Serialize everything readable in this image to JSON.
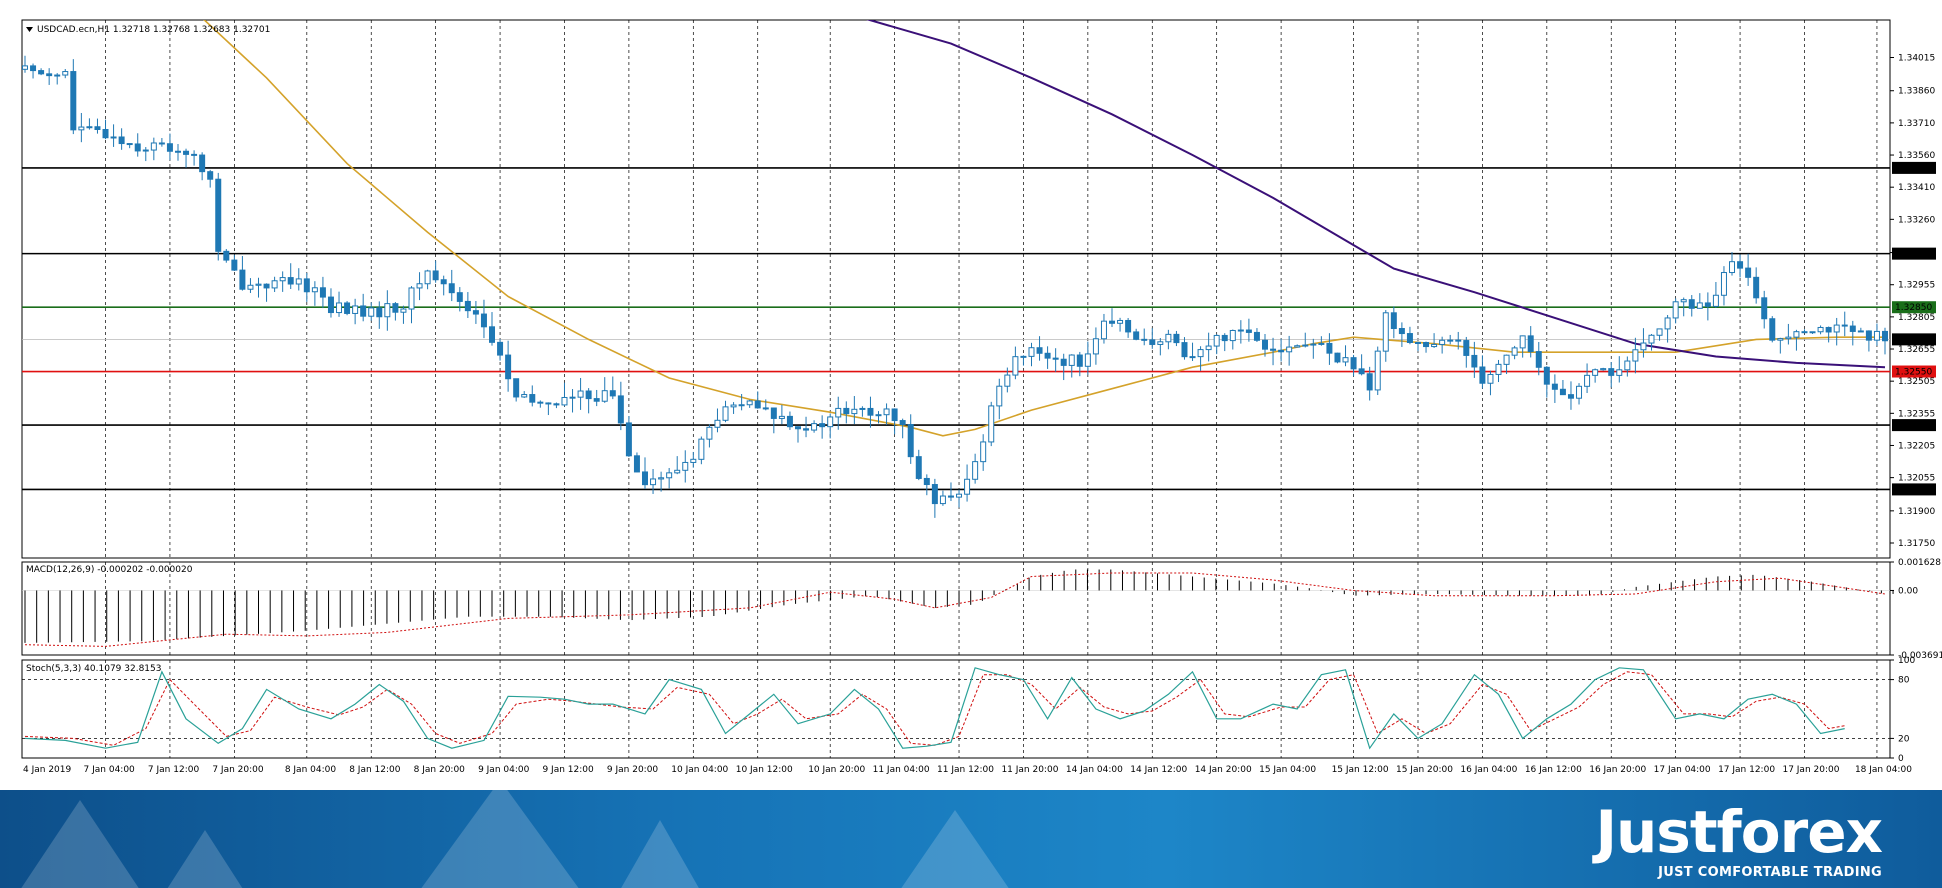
{
  "header": {
    "symbol_line": "USDCAD.ecn,H1  1.32718 1.32768 1.32683 1.32701",
    "macd_label": "MACD(12,26,9) -0.000202 -0.000020",
    "stoch_label": "Stoch(5,3,3) 40.1079 32.8153"
  },
  "brand": {
    "logo": "Justforex",
    "tagline": "JUST COMFORTABLE TRADING"
  },
  "colors": {
    "bull": "#1f78b4",
    "bear": "#1f78b4",
    "ma_fast": "#d4a22a",
    "ma_slow": "#3a1078",
    "red_line": "#e01010",
    "green_line": "#1a6e1a",
    "black_line": "#000000",
    "stoch_main": "#2aa198",
    "stoch_signal": "#d01010"
  },
  "chart_data": [
    {
      "type": "candlestick",
      "symbol": "USDCAD.ecn",
      "timeframe": "H1",
      "ohlc_last": {
        "open": 1.32718,
        "high": 1.32768,
        "low": 1.32683,
        "close": 1.32701
      },
      "ylim": [
        1.3168,
        1.3419
      ],
      "y_ticks": [
        "1.34015",
        "1.33860",
        "1.33710",
        "1.33560",
        "1.33410",
        "1.33260",
        "1.33105",
        "1.32955",
        "1.32805",
        "1.32655",
        "1.32505",
        "1.32355",
        "1.32205",
        "1.32055",
        "1.31900",
        "1.31750"
      ],
      "x_ticks": [
        "4 Jan 2019",
        "7 Jan 04:00",
        "7 Jan 12:00",
        "7 Jan 20:00",
        "8 Jan 04:00",
        "8 Jan 12:00",
        "8 Jan 20:00",
        "9 Jan 04:00",
        "9 Jan 12:00",
        "9 Jan 20:00",
        "10 Jan 04:00",
        "10 Jan 12:00",
        "10 Jan 20:00",
        "11 Jan 04:00",
        "11 Jan 12:00",
        "11 Jan 20:00",
        "14 Jan 04:00",
        "14 Jan 12:00",
        "14 Jan 20:00",
        "15 Jan 04:00",
        "15 Jan 12:00",
        "15 Jan 20:00",
        "16 Jan 04:00",
        "16 Jan 12:00",
        "16 Jan 20:00",
        "17 Jan 04:00",
        "17 Jan 12:00",
        "17 Jan 20:00",
        "18 Jan 04:00"
      ],
      "levels": [
        {
          "value": 1.335,
          "label": "1.33500",
          "style": "black"
        },
        {
          "value": 1.331,
          "label": "1.33100",
          "style": "black"
        },
        {
          "value": 1.3285,
          "label": "1.32850",
          "style": "green"
        },
        {
          "value": 1.327,
          "label": "1.32701",
          "style": "current"
        },
        {
          "value": 1.3255,
          "label": "1.32550",
          "style": "red"
        },
        {
          "value": 1.323,
          "label": "1.32300",
          "style": "black"
        },
        {
          "value": 1.32,
          "label": "1.32000",
          "style": "black"
        }
      ],
      "close_path": [
        [
          0,
          1.3396
        ],
        [
          5,
          1.3394
        ],
        [
          6,
          1.3368
        ],
        [
          10,
          1.3366
        ],
        [
          14,
          1.336
        ],
        [
          17,
          1.336
        ],
        [
          20,
          1.3358
        ],
        [
          23,
          1.3345
        ],
        [
          24,
          1.331
        ],
        [
          27,
          1.3296
        ],
        [
          30,
          1.3296
        ],
        [
          33,
          1.3296
        ],
        [
          36,
          1.3294
        ],
        [
          38,
          1.3285
        ],
        [
          40,
          1.3284
        ],
        [
          43,
          1.3282
        ],
        [
          47,
          1.3286
        ],
        [
          50,
          1.3302
        ],
        [
          53,
          1.3292
        ],
        [
          56,
          1.3282
        ],
        [
          59,
          1.3262
        ],
        [
          61,
          1.3242
        ],
        [
          64,
          1.324
        ],
        [
          67,
          1.3242
        ],
        [
          70,
          1.3244
        ],
        [
          73,
          1.3244
        ],
        [
          75,
          1.3218
        ],
        [
          77,
          1.3204
        ],
        [
          80,
          1.3206
        ],
        [
          83,
          1.3216
        ],
        [
          86,
          1.3234
        ],
        [
          89,
          1.324
        ],
        [
          92,
          1.3236
        ],
        [
          95,
          1.3232
        ],
        [
          98,
          1.3228
        ],
        [
          101,
          1.3236
        ],
        [
          104,
          1.3236
        ],
        [
          107,
          1.3235
        ],
        [
          109,
          1.3228
        ],
        [
          111,
          1.3208
        ],
        [
          113,
          1.3194
        ],
        [
          116,
          1.3196
        ],
        [
          118,
          1.3212
        ],
        [
          121,
          1.325
        ],
        [
          123,
          1.3262
        ],
        [
          126,
          1.3264
        ],
        [
          129,
          1.326
        ],
        [
          131,
          1.326
        ],
        [
          134,
          1.3276
        ],
        [
          137,
          1.3276
        ],
        [
          140,
          1.3266
        ],
        [
          142,
          1.327
        ],
        [
          145,
          1.3262
        ],
        [
          148,
          1.327
        ],
        [
          151,
          1.3276
        ],
        [
          154,
          1.3268
        ],
        [
          157,
          1.3266
        ],
        [
          160,
          1.3268
        ],
        [
          163,
          1.3262
        ],
        [
          165,
          1.3258
        ],
        [
          167,
          1.3244
        ],
        [
          169,
          1.3282
        ],
        [
          172,
          1.327
        ],
        [
          175,
          1.3266
        ],
        [
          178,
          1.327
        ],
        [
          181,
          1.3252
        ],
        [
          184,
          1.3262
        ],
        [
          186,
          1.3272
        ],
        [
          189,
          1.3248
        ],
        [
          192,
          1.3244
        ],
        [
          195,
          1.3254
        ],
        [
          198,
          1.3256
        ],
        [
          201,
          1.3266
        ],
        [
          204,
          1.3282
        ],
        [
          206,
          1.3288
        ],
        [
          209,
          1.3284
        ],
        [
          212,
          1.3306
        ],
        [
          215,
          1.3292
        ],
        [
          217,
          1.3268
        ],
        [
          220,
          1.3276
        ],
        [
          223,
          1.3276
        ],
        [
          226,
          1.3274
        ],
        [
          229,
          1.327
        ],
        [
          231,
          1.3272
        ]
      ],
      "ma_fast_path": [
        [
          22,
          1.342
        ],
        [
          30,
          1.3392
        ],
        [
          40,
          1.3352
        ],
        [
          50,
          1.332
        ],
        [
          60,
          1.329
        ],
        [
          70,
          1.327
        ],
        [
          80,
          1.3252
        ],
        [
          90,
          1.3242
        ],
        [
          100,
          1.3236
        ],
        [
          110,
          1.3229
        ],
        [
          114,
          1.3225
        ],
        [
          118,
          1.3228
        ],
        [
          125,
          1.3237
        ],
        [
          135,
          1.3247
        ],
        [
          145,
          1.3257
        ],
        [
          155,
          1.3264
        ],
        [
          160,
          1.3268
        ],
        [
          165,
          1.3271
        ],
        [
          175,
          1.3268
        ],
        [
          185,
          1.3264
        ],
        [
          195,
          1.3264
        ],
        [
          205,
          1.3264
        ],
        [
          215,
          1.327
        ],
        [
          225,
          1.3271
        ],
        [
          231,
          1.3271
        ]
      ],
      "ma_slow_path": [
        [
          104,
          1.342
        ],
        [
          115,
          1.3408
        ],
        [
          125,
          1.3392
        ],
        [
          135,
          1.3375
        ],
        [
          145,
          1.3356
        ],
        [
          155,
          1.3336
        ],
        [
          165,
          1.3314
        ],
        [
          170,
          1.3303
        ],
        [
          180,
          1.3292
        ],
        [
          190,
          1.328
        ],
        [
          200,
          1.3268
        ],
        [
          210,
          1.3262
        ],
        [
          220,
          1.3259
        ],
        [
          231,
          1.3257
        ]
      ]
    },
    {
      "type": "bar",
      "indicator": "MACD(12,26,9)",
      "main": -0.000202,
      "signal": -2e-05,
      "ylim": [
        -0.003691,
        0.001628
      ],
      "y_ticks": [
        "0.001628",
        "0.00",
        "-0.003691"
      ],
      "hist_path": [
        [
          0,
          -0.003
        ],
        [
          15,
          -0.0029
        ],
        [
          25,
          -0.0026
        ],
        [
          35,
          -0.0023
        ],
        [
          45,
          -0.0019
        ],
        [
          55,
          -0.0015
        ],
        [
          65,
          -0.0015
        ],
        [
          75,
          -0.0017
        ],
        [
          85,
          -0.0015
        ],
        [
          95,
          -0.0008
        ],
        [
          105,
          -0.0003
        ],
        [
          113,
          -0.001
        ],
        [
          118,
          -0.0008
        ],
        [
          125,
          0.0008
        ],
        [
          130,
          0.0012
        ],
        [
          135,
          0.0012
        ],
        [
          145,
          0.0008
        ],
        [
          155,
          0.0004
        ],
        [
          160,
          0.0001
        ],
        [
          165,
          -0.0003
        ],
        [
          175,
          -0.0002
        ],
        [
          185,
          -0.0003
        ],
        [
          195,
          -0.0003
        ],
        [
          200,
          0.0002
        ],
        [
          210,
          0.0008
        ],
        [
          215,
          0.0009
        ],
        [
          222,
          0.0005
        ],
        [
          231,
          -0.0002
        ]
      ],
      "signal_path": [
        [
          0,
          -0.0031
        ],
        [
          10,
          -0.0032
        ],
        [
          25,
          -0.0025
        ],
        [
          35,
          -0.0026
        ],
        [
          45,
          -0.0024
        ],
        [
          60,
          -0.0016
        ],
        [
          75,
          -0.0014
        ],
        [
          90,
          -0.001
        ],
        [
          100,
          -0.0001
        ],
        [
          108,
          -0.0005
        ],
        [
          113,
          -0.001
        ],
        [
          120,
          -0.0004
        ],
        [
          125,
          0.0008
        ],
        [
          135,
          0.001
        ],
        [
          145,
          0.001
        ],
        [
          155,
          0.0006
        ],
        [
          165,
          0.0
        ],
        [
          175,
          -0.0003
        ],
        [
          190,
          -0.0003
        ],
        [
          200,
          -0.0002
        ],
        [
          210,
          0.0005
        ],
        [
          218,
          0.0007
        ],
        [
          231,
          -0.0002
        ]
      ]
    },
    {
      "type": "line",
      "indicator": "Stoch(5,3,3)",
      "main": 40.1079,
      "signal": 32.8153,
      "ylim": [
        0,
        100
      ],
      "y_ticks": [
        "100",
        "80",
        "20",
        "0"
      ],
      "levels": [
        80,
        20
      ],
      "main_path": [
        [
          0,
          20
        ],
        [
          5,
          18
        ],
        [
          10,
          10
        ],
        [
          14,
          16
        ],
        [
          17,
          88
        ],
        [
          20,
          40
        ],
        [
          24,
          15
        ],
        [
          27,
          30
        ],
        [
          30,
          70
        ],
        [
          34,
          50
        ],
        [
          38,
          40
        ],
        [
          41,
          55
        ],
        [
          44,
          75
        ],
        [
          47,
          58
        ],
        [
          50,
          20
        ],
        [
          53,
          10
        ],
        [
          57,
          18
        ],
        [
          60,
          63
        ],
        [
          64,
          62
        ],
        [
          67,
          60
        ],
        [
          70,
          55
        ],
        [
          73,
          55
        ],
        [
          77,
          45
        ],
        [
          80,
          80
        ],
        [
          84,
          70
        ],
        [
          87,
          25
        ],
        [
          90,
          45
        ],
        [
          93,
          65
        ],
        [
          96,
          35
        ],
        [
          100,
          45
        ],
        [
          103,
          70
        ],
        [
          106,
          50
        ],
        [
          109,
          10
        ],
        [
          112,
          12
        ],
        [
          115,
          16
        ],
        [
          118,
          92
        ],
        [
          121,
          85
        ],
        [
          124,
          80
        ],
        [
          127,
          40
        ],
        [
          130,
          82
        ],
        [
          133,
          50
        ],
        [
          136,
          40
        ],
        [
          139,
          48
        ],
        [
          142,
          65
        ],
        [
          145,
          88
        ],
        [
          148,
          40
        ],
        [
          151,
          40
        ],
        [
          155,
          55
        ],
        [
          158,
          50
        ],
        [
          161,
          85
        ],
        [
          164,
          90
        ],
        [
          167,
          10
        ],
        [
          170,
          45
        ],
        [
          173,
          20
        ],
        [
          176,
          35
        ],
        [
          180,
          85
        ],
        [
          183,
          65
        ],
        [
          186,
          20
        ],
        [
          189,
          40
        ],
        [
          192,
          55
        ],
        [
          195,
          80
        ],
        [
          198,
          92
        ],
        [
          201,
          90
        ],
        [
          205,
          40
        ],
        [
          208,
          45
        ],
        [
          211,
          40
        ],
        [
          214,
          60
        ],
        [
          217,
          65
        ],
        [
          220,
          55
        ],
        [
          223,
          25
        ],
        [
          226,
          30
        ]
      ],
      "signal_path": [
        [
          0,
          22
        ],
        [
          6,
          20
        ],
        [
          11,
          13
        ],
        [
          15,
          30
        ],
        [
          18,
          80
        ],
        [
          21,
          55
        ],
        [
          25,
          22
        ],
        [
          28,
          28
        ],
        [
          31,
          62
        ],
        [
          35,
          52
        ],
        [
          39,
          44
        ],
        [
          42,
          52
        ],
        [
          45,
          70
        ],
        [
          48,
          55
        ],
        [
          51,
          25
        ],
        [
          54,
          15
        ],
        [
          58,
          25
        ],
        [
          61,
          55
        ],
        [
          65,
          60
        ],
        [
          68,
          58
        ],
        [
          71,
          55
        ],
        [
          74,
          52
        ],
        [
          78,
          50
        ],
        [
          81,
          72
        ],
        [
          85,
          65
        ],
        [
          88,
          35
        ],
        [
          91,
          45
        ],
        [
          94,
          60
        ],
        [
          97,
          40
        ],
        [
          101,
          45
        ],
        [
          104,
          65
        ],
        [
          107,
          50
        ],
        [
          110,
          15
        ],
        [
          113,
          13
        ],
        [
          116,
          22
        ],
        [
          119,
          85
        ],
        [
          122,
          85
        ],
        [
          125,
          75
        ],
        [
          128,
          50
        ],
        [
          131,
          72
        ],
        [
          134,
          52
        ],
        [
          137,
          45
        ],
        [
          140,
          48
        ],
        [
          143,
          62
        ],
        [
          146,
          80
        ],
        [
          149,
          45
        ],
        [
          152,
          42
        ],
        [
          156,
          52
        ],
        [
          159,
          52
        ],
        [
          162,
          80
        ],
        [
          165,
          85
        ],
        [
          168,
          25
        ],
        [
          171,
          40
        ],
        [
          174,
          25
        ],
        [
          177,
          35
        ],
        [
          181,
          75
        ],
        [
          184,
          65
        ],
        [
          187,
          28
        ],
        [
          190,
          40
        ],
        [
          193,
          52
        ],
        [
          196,
          75
        ],
        [
          199,
          88
        ],
        [
          202,
          85
        ],
        [
          206,
          45
        ],
        [
          209,
          45
        ],
        [
          212,
          42
        ],
        [
          215,
          58
        ],
        [
          218,
          62
        ],
        [
          221,
          55
        ],
        [
          224,
          30
        ],
        [
          226,
          33
        ]
      ]
    }
  ]
}
